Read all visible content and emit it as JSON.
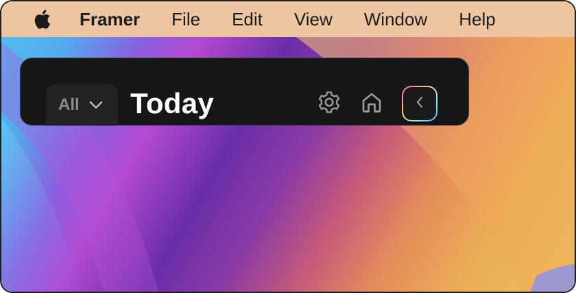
{
  "menubar": {
    "apple_icon": "apple-logo-icon",
    "app_name": "Framer",
    "items": [
      "File",
      "Edit",
      "View",
      "Window",
      "Help"
    ]
  },
  "panel": {
    "filter_label": "All",
    "title": "Today",
    "icons": {
      "filter": "chevron-down-icon",
      "settings": "gear-icon",
      "home": "home-icon",
      "collapse": "chevron-left-icon"
    }
  },
  "colors": {
    "menubar_bg": "#edc5a2",
    "panel_bg": "#161616",
    "panel_text": "#ffffff",
    "muted_text": "#8c8c8c"
  }
}
